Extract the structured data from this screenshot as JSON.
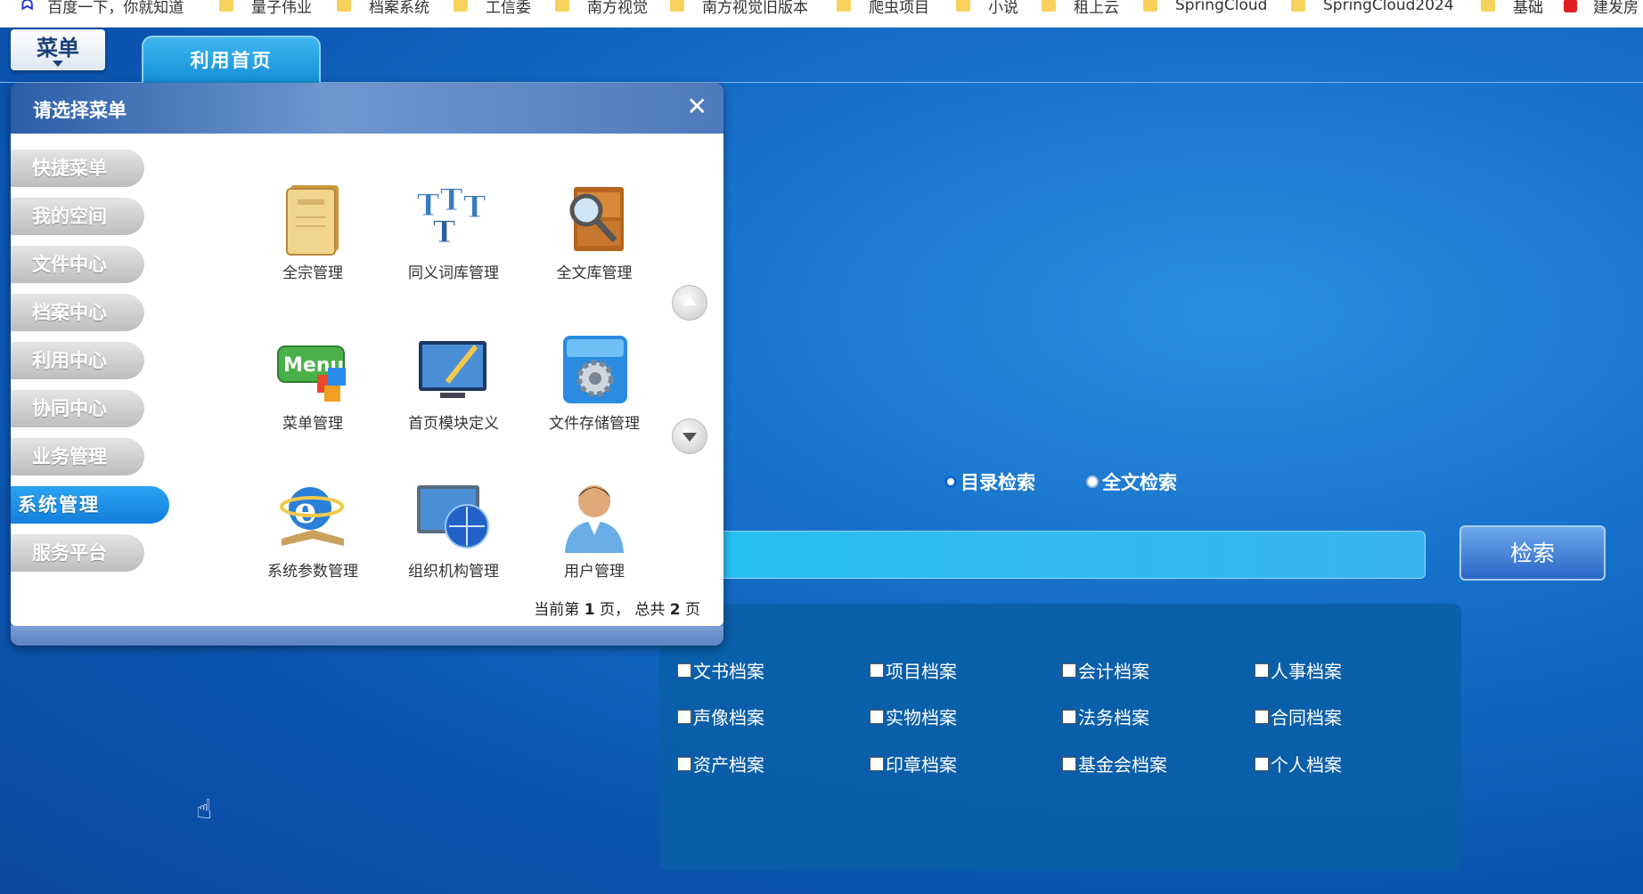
{
  "bookmarks": [
    {
      "label": "百度一下，你就知道",
      "icon": "baidu-icon"
    },
    {
      "label": "量子伟业",
      "icon": "folder-icon"
    },
    {
      "label": "档案系统",
      "icon": "folder-icon"
    },
    {
      "label": "工信委",
      "icon": "folder-icon"
    },
    {
      "label": "南方视觉",
      "icon": "folder-icon"
    },
    {
      "label": "南方视觉旧版本",
      "icon": "folder-icon"
    },
    {
      "label": "爬虫项目",
      "icon": "folder-icon"
    },
    {
      "label": "小说",
      "icon": "folder-icon"
    },
    {
      "label": "租上云",
      "icon": "folder-icon"
    },
    {
      "label": "SpringCloud",
      "icon": "folder-icon"
    },
    {
      "label": "SpringCloud2024",
      "icon": "folder-icon"
    },
    {
      "label": "基础",
      "icon": "folder-icon"
    },
    {
      "label": "建发房",
      "icon": "site-icon"
    }
  ],
  "topbar": {
    "menu_label": "菜单",
    "home_tab": "利用首页"
  },
  "panel": {
    "title": "请选择菜单",
    "close": "✕",
    "side_menu": [
      "快捷菜单",
      "我的空间",
      "文件中心",
      "档案中心",
      "利用中心",
      "协同中心",
      "业务管理",
      "系统管理",
      "服务平台"
    ],
    "active_item": "系统管理",
    "apps": [
      {
        "label": "全宗管理",
        "icon": "book-icon"
      },
      {
        "label": "同义词库管理",
        "icon": "letters-icon"
      },
      {
        "label": "全文库管理",
        "icon": "file-cabinet-search-icon"
      },
      {
        "label": "菜单管理",
        "icon": "menu-sign-icon"
      },
      {
        "label": "首页模块定义",
        "icon": "monitor-pen-icon"
      },
      {
        "label": "文件存储管理",
        "icon": "storage-gear-icon"
      },
      {
        "label": "系统参数管理",
        "icon": "ie-book-icon"
      },
      {
        "label": "组织机构管理",
        "icon": "network-globe-icon"
      },
      {
        "label": "用户管理",
        "icon": "user-icon"
      }
    ],
    "pager": {
      "prefix": "当前第",
      "current": "1",
      "mid": "页，  总共",
      "total": "2",
      "suffix": "页"
    }
  },
  "search": {
    "radio_catalog": "目录检索",
    "radio_fulltext": "全文检索",
    "button": "检索",
    "categories": [
      "文书档案",
      "项目档案",
      "会计档案",
      "人事档案",
      "声像档案",
      "实物档案",
      "法务档案",
      "合同档案",
      "资产档案",
      "印章档案",
      "基金会档案",
      "个人档案"
    ]
  }
}
